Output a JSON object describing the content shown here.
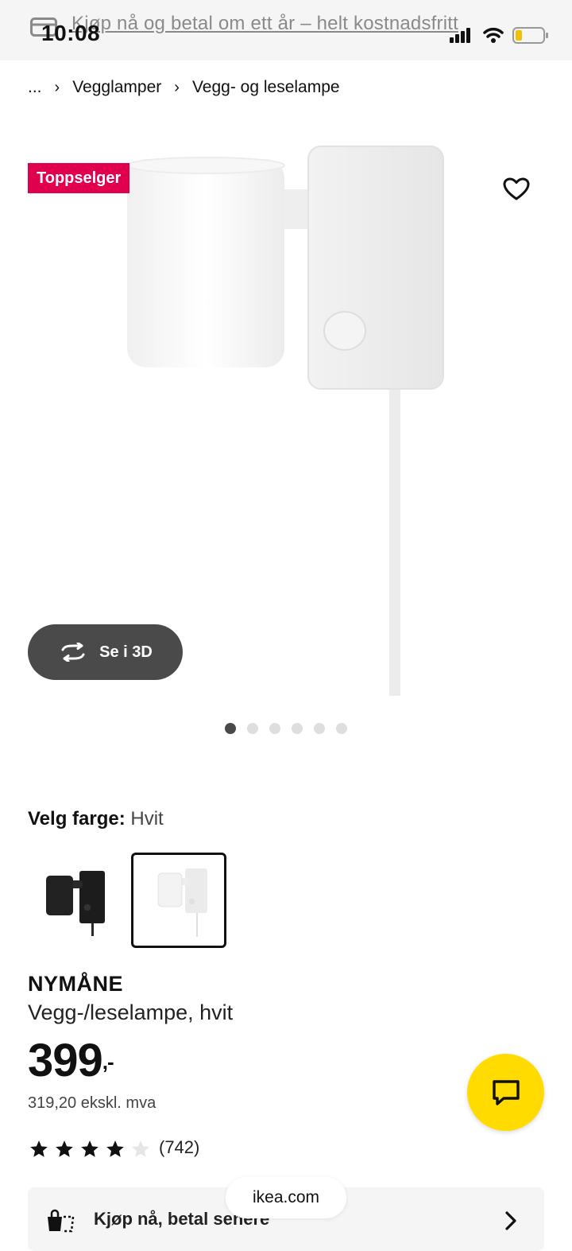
{
  "banner": {
    "text": "Kjøp nå og betal om ett år – helt kostnadsfritt"
  },
  "status_bar": {
    "time": "10:08"
  },
  "breadcrumb": {
    "ellipsis": "...",
    "items": [
      "Vegglamper",
      "Vegg- og leselampe"
    ]
  },
  "product_image": {
    "badge": "Toppselger",
    "view_3d_label": "Se i 3D",
    "carousel_count": 6,
    "carousel_active": 1
  },
  "color_select": {
    "label": "Velg farge:",
    "value": "Hvit",
    "options": [
      "black",
      "white"
    ],
    "selected": "white"
  },
  "product": {
    "name": "NYMÅNE",
    "description": "Vegg-/leselampe, hvit",
    "price_main": "399",
    "price_decimal": ",-",
    "price_ex_vat": "319,20 ekskl. mva",
    "rating": 4,
    "rating_max": 5,
    "review_count": "(742)"
  },
  "bnpl": {
    "label": "Kjøp nå, betal senere"
  },
  "browser": {
    "url": "ikea.com"
  },
  "colors": {
    "badge": "#e0004d",
    "chat": "#ffdb00",
    "button_3d": "#4a4a4a"
  }
}
